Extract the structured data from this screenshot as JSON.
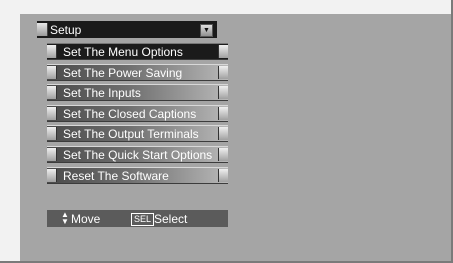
{
  "menu_title": "Setup",
  "menu_items": [
    {
      "label": "Set The Menu Options",
      "selected": true
    },
    {
      "label": "Set The Power Saving",
      "selected": false
    },
    {
      "label": "Set The Inputs",
      "selected": false
    },
    {
      "label": "Set The Closed Captions",
      "selected": false
    },
    {
      "label": "Set  The Output Terminals",
      "selected": false
    },
    {
      "label": "Set The Quick Start Options",
      "selected": false
    },
    {
      "label": "Reset The Software",
      "selected": false
    }
  ],
  "help_bar": {
    "move_icon": "up-down-arrows-icon",
    "move_label": "Move",
    "select_key": "SEL",
    "select_label": "Select"
  },
  "colors": {
    "background": "#a5a5a5",
    "title_bg": "#1a1a1a",
    "selected_bg": "#1b1b1b",
    "help_bg": "#5b5b5b"
  }
}
